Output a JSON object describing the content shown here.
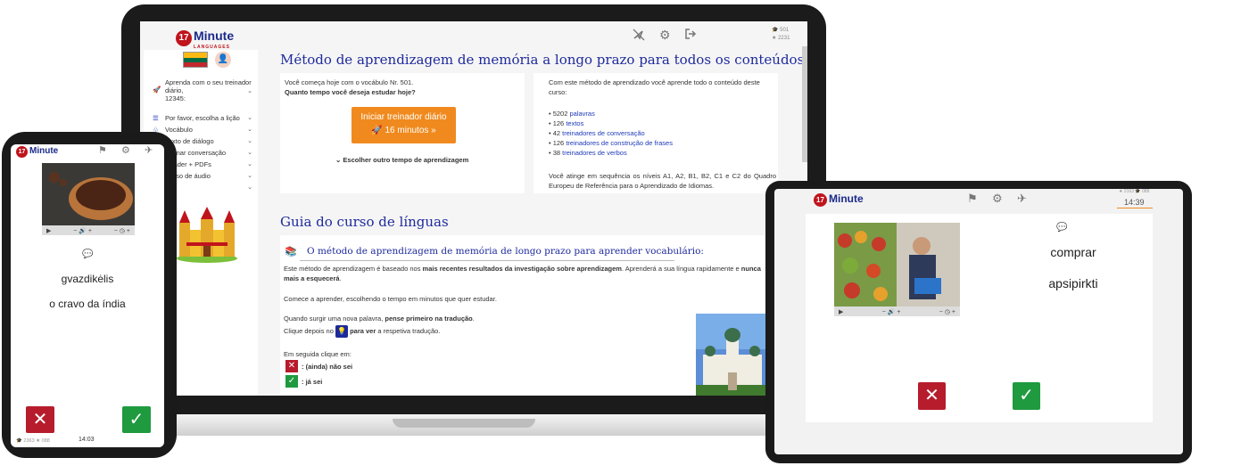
{
  "laptop": {
    "topbar": {
      "logo_number": "17",
      "logo_word": "Minute",
      "logo_sub": "LANGUAGES",
      "stat_vocab": "501",
      "stat_stars": "2231"
    },
    "sidebar": {
      "trainer_label": "Aprenda com o seu treinador diário,",
      "trainer_id": "12345:",
      "items": [
        {
          "label": "Por favor, escolha a lição"
        },
        {
          "label": "Vocábulo"
        },
        {
          "label": "Texto de diálogo"
        },
        {
          "label": "Treinar conversação"
        },
        {
          "label": "Reader + PDFs"
        },
        {
          "label": "Curso de áudio"
        }
      ]
    },
    "main": {
      "title": "Método de aprendizagem de memória a longo prazo para todos os conteúdos deste curso",
      "start_line": "Você começa hoje com o vocábulo Nr. 501.",
      "question": "Quanto tempo você deseja estudar hoje?",
      "start_button_line1": "Iniciar treinador diário",
      "start_button_line2": "16 minutos »",
      "other_time": "Escolher outro tempo de aprendizagem",
      "info_intro": "Com este método de aprendizado você aprende todo o conteúdo deste curso:",
      "content_items": [
        {
          "count": "5202",
          "link": "palavras"
        },
        {
          "count": "126",
          "link": "textos"
        },
        {
          "count": "42",
          "link": "treinadores de conversação"
        },
        {
          "count": "126",
          "link": "treinadores de construção de frases"
        },
        {
          "count": "38",
          "link": "treinadores de verbos"
        }
      ],
      "levels_text": "Você atinge em sequência os níveis A1, A2, B1, B2, C1 e C2 do Quadro Europeu de Referência para o Aprendizado de Idiomas.",
      "guide_title": "Guia do curso de línguas",
      "guide_sub": "O método de aprendizagem de memória de longo prazo para aprender vocabulário:",
      "guide_p1_a": "Este método de aprendizagem é baseado nos ",
      "guide_p1_b": "mais recentes resultados da investigação sobre aprendizagem",
      "guide_p1_c": ". Aprenderá a sua língua rapidamente e ",
      "guide_p1_d": "nunca mais a esquecerá",
      "guide_p2": "Comece a aprender, escolhendo o tempo em minutos que quer estudar.",
      "guide_p3_a": "Quando surgir uma nova palavra, ",
      "guide_p3_b": "pense primeiro na tradução",
      "guide_p4_a": "Clique depois no",
      "guide_p4_b": "para ver",
      "guide_p4_c": "a respetiva tradução.",
      "guide_p5": "Em seguida clique em:",
      "no_label": ": (ainda) não sei",
      "yes_label": ": já sei"
    }
  },
  "phone": {
    "logo_number": "17",
    "logo_word": "Minute",
    "word_lt": "gvazdikėlis",
    "word_pt": "o cravo da índia",
    "stat_vocab": "2363",
    "stat_stars": "088",
    "timer": "14:03"
  },
  "tablet": {
    "logo_number": "17",
    "logo_word": "Minute",
    "stat_vocab": "2163",
    "stat_stars": "088",
    "timer": "14:39",
    "word_pt": "comprar",
    "word_lt": "apsipirkti"
  },
  "colors": {
    "brand_blue": "#1b2a8a",
    "brand_red": "#c0141c",
    "orange": "#f08a1e",
    "no_red": "#b71c2c",
    "yes_green": "#1f9a3f",
    "link_blue": "#1e3ab8"
  },
  "icons": [
    "graduation-cap-icon",
    "star-icon",
    "nav-off-icon",
    "gear-icon",
    "logout-icon",
    "rocket-icon",
    "list-icon",
    "chevron-down-icon",
    "speech-bubble-icon",
    "play-icon",
    "volume-icon",
    "lightbulb-icon",
    "close-icon",
    "check-icon",
    "runner-icon"
  ]
}
